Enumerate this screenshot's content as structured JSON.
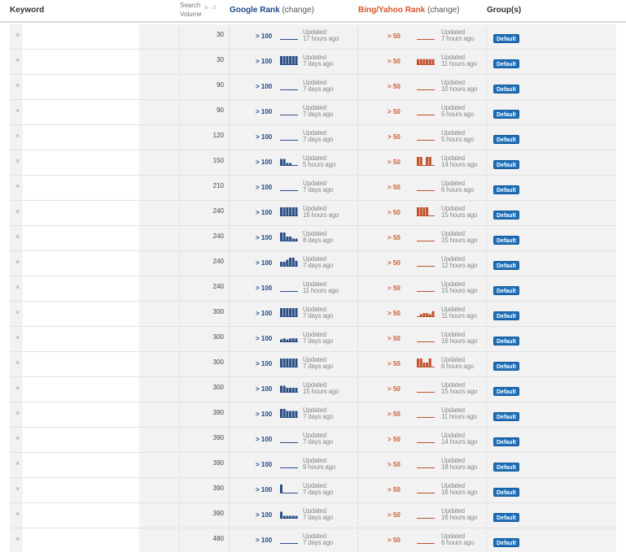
{
  "header": {
    "keyword": "Keyword",
    "search_volume_line1": "Search",
    "search_volume_line2": "Volume",
    "sort_hint": "a→z",
    "google_rank": "Google Rank",
    "google_change": "(change)",
    "bing_rank": "Bing/Yahoo Rank",
    "bing_change": "(change)",
    "groups": "Group(s)"
  },
  "colors": {
    "google": "#1b4a8a",
    "bing": "#d9542a",
    "button": "#1e6fb8",
    "google_spark": "#2a4f85",
    "bing_spark": "#c0502a"
  },
  "delete_symbol": "×",
  "updated_label": "Updated",
  "rows": [
    {
      "volume": "30",
      "g_rank": "> 100",
      "g_upd": "17 hours ago",
      "g_spark": [
        0,
        0,
        0,
        0,
        0,
        0
      ],
      "b_rank": "> 50",
      "b_upd": "7 hours ago",
      "b_spark": [
        0,
        0,
        0,
        0,
        0,
        0
      ],
      "group": "Default"
    },
    {
      "volume": "30",
      "g_rank": "> 100",
      "g_upd": "7 days ago",
      "g_spark": [
        8,
        8,
        8,
        8,
        8,
        8
      ],
      "b_rank": "> 50",
      "b_upd": "11 hours ago",
      "b_spark": [
        5,
        5,
        5,
        5,
        5,
        5
      ],
      "group": "Default"
    },
    {
      "volume": "90",
      "g_rank": "> 100",
      "g_upd": "7 days ago",
      "g_spark": [
        0,
        0,
        0,
        0,
        0,
        0
      ],
      "b_rank": "> 50",
      "b_upd": "10 hours ago",
      "b_spark": [
        0,
        0,
        0,
        0,
        0,
        0
      ],
      "group": "Default"
    },
    {
      "volume": "90",
      "g_rank": "> 100",
      "g_upd": "7 days ago",
      "g_spark": [
        0,
        0,
        0,
        0,
        0,
        0
      ],
      "b_rank": "> 50",
      "b_upd": "5 hours ago",
      "b_spark": [
        0,
        0,
        0,
        0,
        0,
        0
      ],
      "group": "Default"
    },
    {
      "volume": "120",
      "g_rank": "> 100",
      "g_upd": "7 days ago",
      "g_spark": [
        0,
        0,
        0,
        0,
        0,
        0
      ],
      "b_rank": "> 50",
      "b_upd": "5 hours ago",
      "b_spark": [
        0,
        0,
        0,
        0,
        0,
        0
      ],
      "group": "Default"
    },
    {
      "volume": "150",
      "g_rank": "> 100",
      "g_upd": "5 hours ago",
      "g_spark": [
        6,
        6,
        2,
        2,
        0,
        0
      ],
      "b_rank": "> 50",
      "b_upd": "14 hours ago",
      "b_spark": [
        8,
        8,
        0,
        8,
        8,
        0
      ],
      "group": "Default"
    },
    {
      "volume": "210",
      "g_rank": "> 100",
      "g_upd": "7 days ago",
      "g_spark": [
        0,
        0,
        0,
        0,
        0,
        0
      ],
      "b_rank": "> 50",
      "b_upd": "6 hours ago",
      "b_spark": [
        0,
        0,
        0,
        0,
        0,
        0
      ],
      "group": "Default"
    },
    {
      "volume": "240",
      "g_rank": "> 100",
      "g_upd": "16 hours ago",
      "g_spark": [
        8,
        8,
        8,
        8,
        8,
        8
      ],
      "b_rank": "> 50",
      "b_upd": "15 hours ago",
      "b_spark": [
        8,
        8,
        8,
        8,
        0,
        0
      ],
      "group": "Default"
    },
    {
      "volume": "240",
      "g_rank": "> 100",
      "g_upd": "8 days ago",
      "g_spark": [
        8,
        8,
        4,
        4,
        2,
        2
      ],
      "b_rank": "> 50",
      "b_upd": "15 hours ago",
      "b_spark": [
        0,
        0,
        0,
        0,
        0,
        0
      ],
      "group": "Default"
    },
    {
      "volume": "240",
      "g_rank": "> 100",
      "g_upd": "7 days ago",
      "g_spark": [
        4,
        4,
        6,
        8,
        8,
        5
      ],
      "b_rank": "> 50",
      "b_upd": "12 hours ago",
      "b_spark": [
        0,
        0,
        0,
        0,
        0,
        0
      ],
      "group": "Default"
    },
    {
      "volume": "240",
      "g_rank": "> 100",
      "g_upd": "11 hours ago",
      "g_spark": [
        0,
        0,
        0,
        0,
        0,
        0
      ],
      "b_rank": "> 50",
      "b_upd": "15 hours ago",
      "b_spark": [
        0,
        0,
        0,
        0,
        0,
        0
      ],
      "group": "Default"
    },
    {
      "volume": "300",
      "g_rank": "> 100",
      "g_upd": "7 days ago",
      "g_spark": [
        8,
        8,
        8,
        8,
        8,
        8
      ],
      "b_rank": "> 50",
      "b_upd": "11 hours ago",
      "b_spark": [
        0,
        2,
        3,
        3,
        2,
        5
      ],
      "group": "Default"
    },
    {
      "volume": "300",
      "g_rank": "> 100",
      "g_upd": "7 days ago",
      "g_spark": [
        2,
        3,
        2,
        3,
        3,
        3
      ],
      "b_rank": "> 50",
      "b_upd": "16 hours ago",
      "b_spark": [
        0,
        0,
        0,
        0,
        0,
        0
      ],
      "group": "Default"
    },
    {
      "volume": "300",
      "g_rank": "> 100",
      "g_upd": "7 days ago",
      "g_spark": [
        8,
        8,
        8,
        8,
        8,
        8
      ],
      "b_rank": "> 50",
      "b_upd": "6 hours ago",
      "b_spark": [
        8,
        8,
        4,
        4,
        8,
        0
      ],
      "group": "Default"
    },
    {
      "volume": "300",
      "g_rank": "> 100",
      "g_upd": "15 hours ago",
      "g_spark": [
        6,
        6,
        4,
        4,
        4,
        4
      ],
      "b_rank": "> 50",
      "b_upd": "15 hours ago",
      "b_spark": [
        0,
        0,
        0,
        0,
        0,
        0
      ],
      "group": "Default"
    },
    {
      "volume": "390",
      "g_rank": "> 100",
      "g_upd": "7 days ago",
      "g_spark": [
        8,
        8,
        6,
        6,
        6,
        6
      ],
      "b_rank": "> 50",
      "b_upd": "11 hours ago",
      "b_spark": [
        0,
        0,
        0,
        0,
        0,
        0
      ],
      "group": "Default"
    },
    {
      "volume": "390",
      "g_rank": "> 100",
      "g_upd": "7 days ago",
      "g_spark": [
        0,
        0,
        0,
        0,
        0,
        0
      ],
      "b_rank": "> 50",
      "b_upd": "14 hours ago",
      "b_spark": [
        0,
        0,
        0,
        0,
        0,
        0
      ],
      "group": "Default"
    },
    {
      "volume": "390",
      "g_rank": "> 100",
      "g_upd": "9 hours ago",
      "g_spark": [
        0,
        0,
        0,
        0,
        0,
        0
      ],
      "b_rank": "> 50",
      "b_upd": "18 hours ago",
      "b_spark": [
        0,
        0,
        0,
        0,
        0,
        0
      ],
      "group": "Default"
    },
    {
      "volume": "390",
      "g_rank": "> 100",
      "g_upd": "7 days ago",
      "g_spark": [
        8,
        0,
        0,
        0,
        0,
        0
      ],
      "b_rank": "> 50",
      "b_upd": "16 hours ago",
      "b_spark": [
        0,
        0,
        0,
        0,
        0,
        0
      ],
      "group": "Default"
    },
    {
      "volume": "390",
      "g_rank": "> 100",
      "g_upd": "7 days ago",
      "g_spark": [
        6,
        2,
        2,
        2,
        2,
        2
      ],
      "b_rank": "> 50",
      "b_upd": "16 hours ago",
      "b_spark": [
        0,
        0,
        0,
        0,
        0,
        0
      ],
      "group": "Default"
    },
    {
      "volume": "480",
      "g_rank": "> 100",
      "g_upd": "7 days ago",
      "g_spark": [
        0,
        0,
        0,
        0,
        0,
        0
      ],
      "b_rank": "> 50",
      "b_upd": "6 hours ago",
      "b_spark": [
        0,
        0,
        0,
        0,
        0,
        0
      ],
      "group": "Default"
    }
  ]
}
